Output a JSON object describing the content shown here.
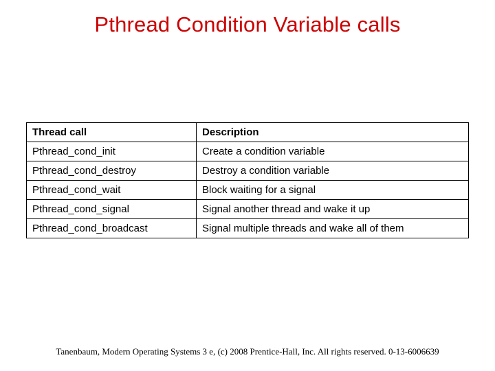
{
  "title": "Pthread Condition Variable calls",
  "table": {
    "headers": {
      "col1": "Thread call",
      "col2": "Description"
    },
    "rows": [
      {
        "call": "Pthread_cond_init",
        "desc": "Create a condition variable"
      },
      {
        "call": "Pthread_cond_destroy",
        "desc": "Destroy a condition variable"
      },
      {
        "call": "Pthread_cond_wait",
        "desc": "Block waiting for a signal"
      },
      {
        "call": "Pthread_cond_signal",
        "desc": "Signal another thread and wake it up"
      },
      {
        "call": "Pthread_cond_broadcast",
        "desc": "Signal multiple threads and wake all of them"
      }
    ]
  },
  "footer": "Tanenbaum, Modern Operating Systems 3 e, (c) 2008 Prentice-Hall, Inc. All rights reserved. 0-13-6006639"
}
